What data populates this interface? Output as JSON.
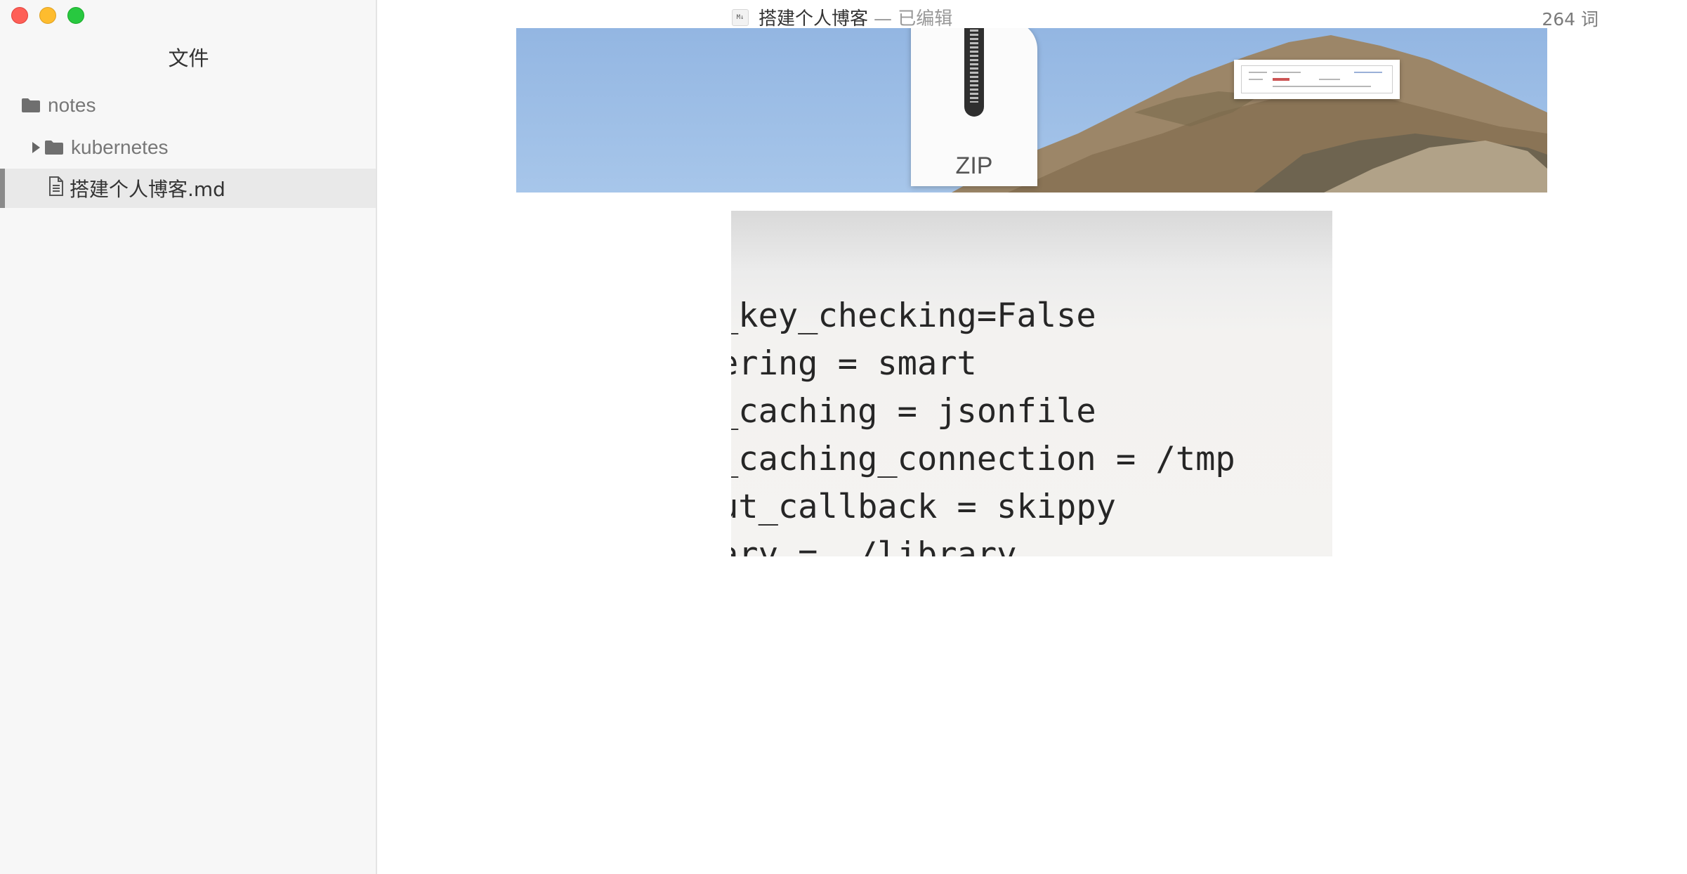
{
  "window": {
    "buttons": {
      "close": "close",
      "minimize": "minimize",
      "maximize": "maximize"
    }
  },
  "sidebar": {
    "title": "文件",
    "tree": {
      "root": {
        "label": "notes",
        "icon": "folder-icon"
      },
      "children": [
        {
          "label": "kubernetes",
          "icon": "folder-icon",
          "expanded": false
        },
        {
          "label": "搭建个人博客.md",
          "icon": "document-icon",
          "selected": true
        }
      ]
    }
  },
  "titlebar": {
    "doc_icon_text": "M↓",
    "doc_name": "搭建个人博客",
    "doc_status": "— 已编辑",
    "word_count": "264 词"
  },
  "content": {
    "banner_image": {
      "zip_label": "ZIP"
    },
    "code_image": {
      "lines": [
        "_key_checking=False",
        "ering = smart",
        "_caching = jsonfile",
        "_caching_connection = /tmp",
        "ut_callback = skippy",
        "ary = ./library"
      ]
    }
  },
  "colors": {
    "sidebar_bg": "#f7f7f7",
    "selected_bg": "#e9e9e9",
    "selected_marker": "#8a8a8a",
    "close": "#fe5f57",
    "minimize": "#febc2e",
    "maximize": "#28c840"
  }
}
